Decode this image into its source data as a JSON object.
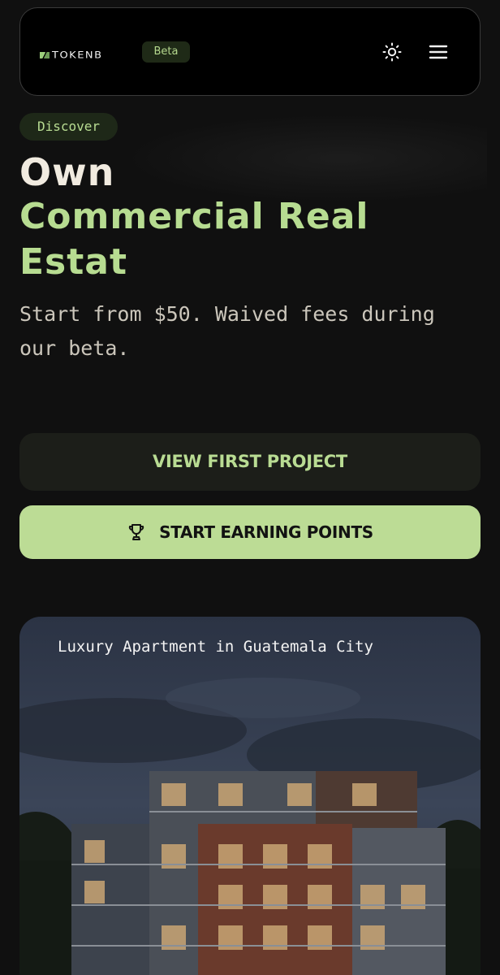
{
  "header": {
    "logo_text": "TOKENB",
    "badge": "Beta",
    "icons": [
      "sun-icon",
      "menu-icon"
    ]
  },
  "hero": {
    "tag": "Discover",
    "title_line1": "Own",
    "title_line2": "Commercial Real",
    "title_line3": "Estat",
    "subtitle": "Start from $50. Waived fees during our beta."
  },
  "actions": {
    "view_project": "VIEW FIRST PROJECT",
    "start_earning": "START EARNING POINTS",
    "trophy_icon": "trophy-icon"
  },
  "project_card": {
    "title": "Luxury Apartment in Guatemala City"
  },
  "colors": {
    "background": "#101010",
    "accent_green": "#b7dc91",
    "button_light": "#bcdc95",
    "button_dark": "#1c1e19",
    "text_light": "#f1ebe0"
  }
}
